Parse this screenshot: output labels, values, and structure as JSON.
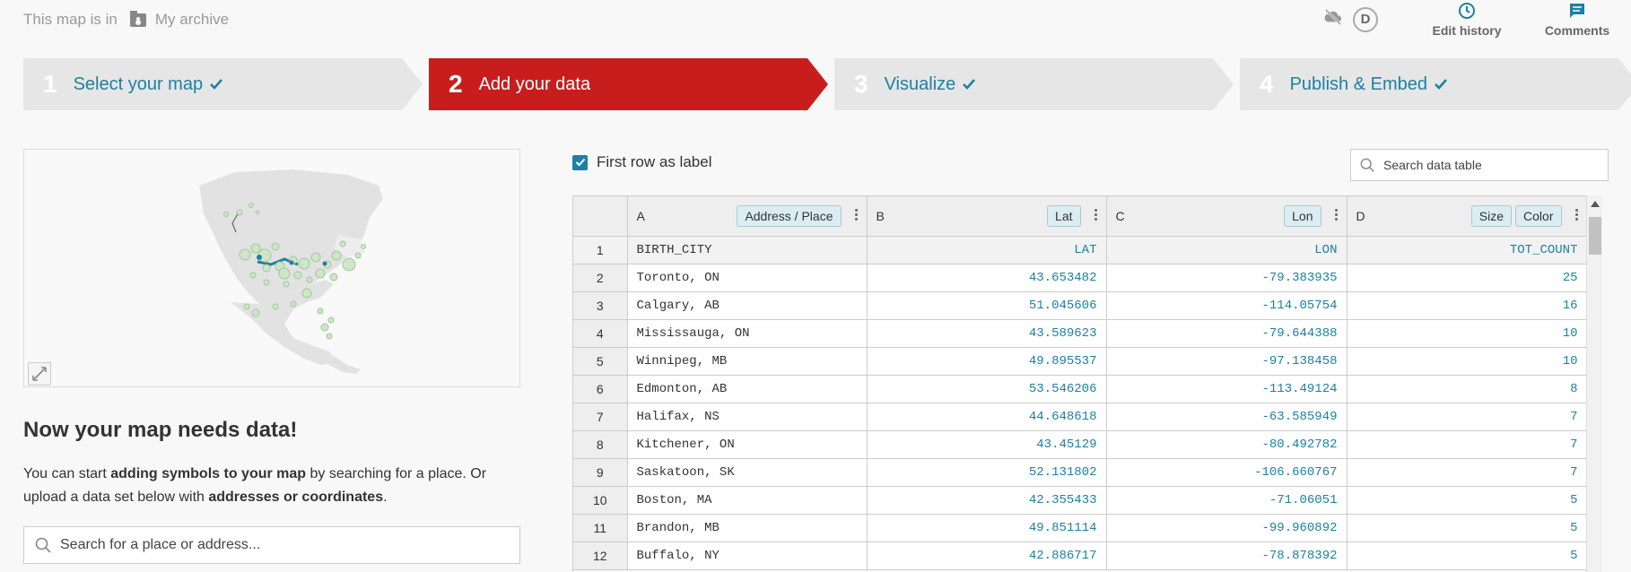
{
  "header": {
    "archive_prefix": "This map is in",
    "archive_name": "My archive",
    "avatar_initial": "D",
    "edit_history": "Edit history",
    "comments": "Comments"
  },
  "steps": [
    {
      "num": "1",
      "label": "Select your map",
      "done": true
    },
    {
      "num": "2",
      "label": "Add your data",
      "done": false,
      "active": true
    },
    {
      "num": "3",
      "label": "Visualize",
      "done": true
    },
    {
      "num": "4",
      "label": "Publish & Embed",
      "done": true
    }
  ],
  "left": {
    "title": "Now your map needs data!",
    "para_1": "You can start ",
    "para_bold_1": "adding symbols to your map",
    "para_2": " by searching for a place. Or upload a data set below with ",
    "para_bold_2": "addresses or coordinates",
    "para_3": ".",
    "search_placeholder": "Search for a place or address..."
  },
  "table_controls": {
    "first_row_label": "First row as label",
    "search_placeholder": "Search data table"
  },
  "table": {
    "columns": [
      {
        "letter": "A",
        "tags": [
          "Address / Place"
        ]
      },
      {
        "letter": "B",
        "tags": [
          "Lat"
        ]
      },
      {
        "letter": "C",
        "tags": [
          "Lon"
        ]
      },
      {
        "letter": "D",
        "tags": [
          "Size",
          "Color"
        ]
      }
    ],
    "rows": [
      {
        "n": "1",
        "city": "BIRTH_CITY",
        "lat": "LAT",
        "lon": "LON",
        "count": "TOT_COUNT"
      },
      {
        "n": "2",
        "city": "Toronto, ON",
        "lat": "43.653482",
        "lon": "-79.383935",
        "count": "25"
      },
      {
        "n": "3",
        "city": "Calgary, AB",
        "lat": "51.045606",
        "lon": "-114.05754",
        "count": "16"
      },
      {
        "n": "4",
        "city": "Mississauga, ON",
        "lat": "43.589623",
        "lon": "-79.644388",
        "count": "10"
      },
      {
        "n": "5",
        "city": "Winnipeg, MB",
        "lat": "49.895537",
        "lon": "-97.138458",
        "count": "10"
      },
      {
        "n": "6",
        "city": "Edmonton, AB",
        "lat": "53.546206",
        "lon": "-113.49124",
        "count": "8"
      },
      {
        "n": "7",
        "city": "Halifax, NS",
        "lat": "44.648618",
        "lon": "-63.585949",
        "count": "7"
      },
      {
        "n": "8",
        "city": "Kitchener, ON",
        "lat": "43.45129",
        "lon": "-80.492782",
        "count": "7"
      },
      {
        "n": "9",
        "city": "Saskatoon, SK",
        "lat": "52.131802",
        "lon": "-106.660767",
        "count": "7"
      },
      {
        "n": "10",
        "city": "Boston, MA",
        "lat": "42.355433",
        "lon": "-71.06051",
        "count": "5"
      },
      {
        "n": "11",
        "city": "Brandon, MB",
        "lat": "49.851114",
        "lon": "-99.960892",
        "count": "5"
      },
      {
        "n": "12",
        "city": "Buffalo, NY",
        "lat": "42.886717",
        "lon": "-78.878392",
        "count": "5"
      }
    ]
  },
  "colors": {
    "accent": "#1d81a2",
    "active_step": "#c71e1d",
    "step_bg": "#e6e6e6"
  }
}
